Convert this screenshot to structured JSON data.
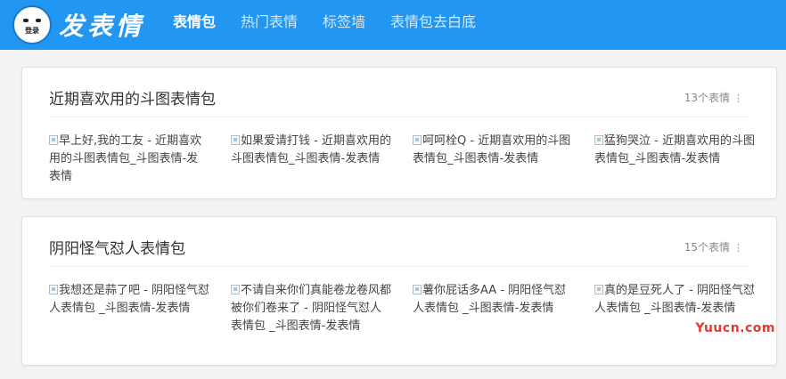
{
  "header": {
    "logo_text": "发表情",
    "logo_face_text": "登录",
    "nav": [
      {
        "label": "表情包",
        "active": true
      },
      {
        "label": "热门表情",
        "active": false
      },
      {
        "label": "标签墙",
        "active": false
      },
      {
        "label": "表情包去白底",
        "active": false
      }
    ]
  },
  "sections": [
    {
      "title": "近期喜欢用的斗图表情包",
      "count": "13个表情",
      "items": [
        {
          "alt": "早上好,我的工友 - 近期喜欢用的斗图表情包_斗图表情-发表情"
        },
        {
          "alt": "如果爱请打钱 - 近期喜欢用的斗图表情包_斗图表情-发表情"
        },
        {
          "alt": "呵呵栓Q - 近期喜欢用的斗图表情包_斗图表情-发表情"
        },
        {
          "alt": "猛狗哭泣 - 近期喜欢用的斗图表情包_斗图表情-发表情"
        }
      ]
    },
    {
      "title": "阴阳怪气怼人表情包",
      "count": "15个表情",
      "items": [
        {
          "alt": "我想还是蒜了吧 - 阴阳怪气怼人表情包 _斗图表情-发表情"
        },
        {
          "alt": "不请自来你们真能卷龙卷风都被你们卷来了 - 阴阳怪气怼人表情包 _斗图表情-发表情"
        },
        {
          "alt": "薯你屁话多AA - 阴阳怪气怼人表情包 _斗图表情-发表情"
        },
        {
          "alt": "真的是豆死人了 - 阴阳怪气怼人表情包 _斗图表情-发表情"
        }
      ]
    }
  ],
  "watermark": "Yuucn.com"
}
